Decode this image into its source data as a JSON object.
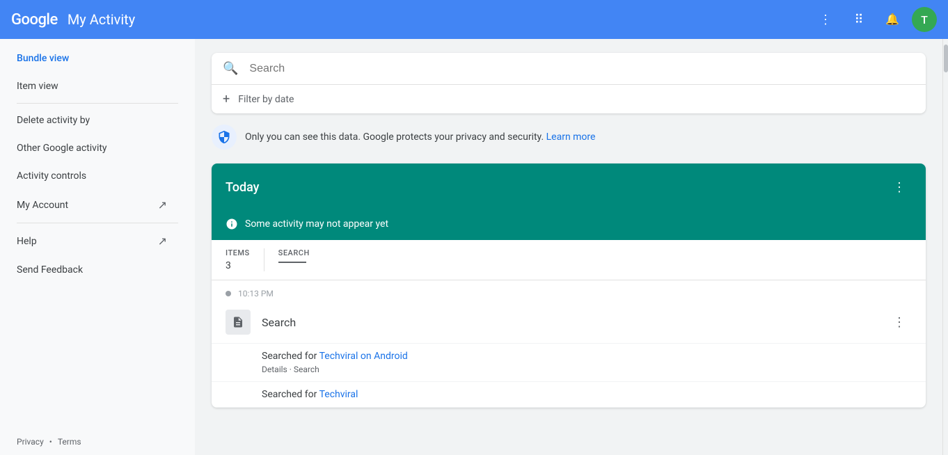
{
  "header": {
    "logo": "Google",
    "title": "My Activity",
    "icons": {
      "more_vert": "⋮",
      "apps": "⠿",
      "notifications": "🔔",
      "avatar_letter": "T"
    }
  },
  "sidebar": {
    "items": [
      {
        "label": "Bundle view",
        "active": true,
        "external": false
      },
      {
        "label": "Item view",
        "active": false,
        "external": false
      }
    ],
    "secondary_items": [
      {
        "label": "Delete activity by",
        "external": false
      },
      {
        "label": "Other Google activity",
        "external": false
      },
      {
        "label": "Activity controls",
        "external": false
      },
      {
        "label": "My Account",
        "external": true
      }
    ],
    "tertiary_items": [
      {
        "label": "Help",
        "external": true
      },
      {
        "label": "Send Feedback",
        "external": false
      }
    ],
    "footer": {
      "privacy": "Privacy",
      "dot": "•",
      "terms": "Terms"
    }
  },
  "search": {
    "placeholder": "Search",
    "filter_label": "Filter by date"
  },
  "privacy_notice": {
    "text": "Only you can see this data. Google protects your privacy and security.",
    "link_text": "Learn more"
  },
  "today": {
    "header": "Today",
    "notice": "Some activity may not appear yet",
    "stats": {
      "items_label": "ITEMS",
      "items_value": "3",
      "search_label": "SEARCH"
    }
  },
  "activity": {
    "time": "10:13 PM",
    "title": "Search",
    "items": [
      {
        "prefix": "Searched for",
        "link_text": "Techviral on Android",
        "meta_detail": "Details",
        "meta_search": "Search"
      },
      {
        "prefix": "Searched for",
        "link_text": "Techviral",
        "meta_detail": "",
        "meta_search": ""
      }
    ]
  }
}
